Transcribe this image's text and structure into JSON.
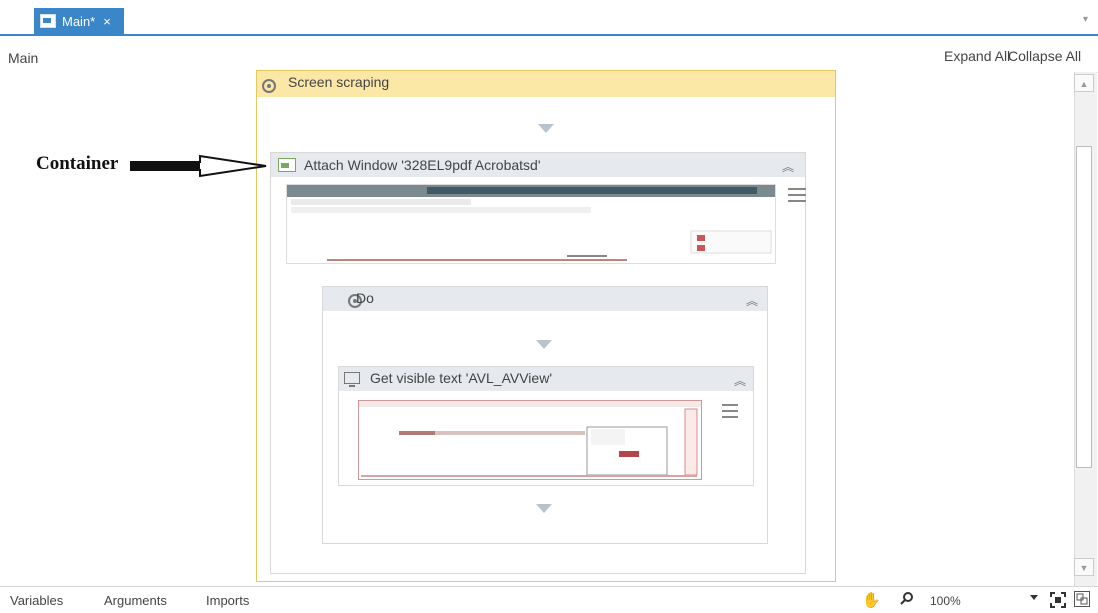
{
  "tab": {
    "label": "Main*",
    "close": "×"
  },
  "header": {
    "breadcrumb": "Main",
    "expand_all": "Expand All",
    "collapse_all": "Collapse All"
  },
  "annotation": {
    "label": "Container"
  },
  "sequence": {
    "title": "Screen scraping"
  },
  "attach": {
    "title": "Attach Window '328EL9pdf Acrobatsd'"
  },
  "do": {
    "title": "Do"
  },
  "get_visible_text": {
    "title": "Get visible text 'AVL_AVView'"
  },
  "bottom": {
    "variables": "Variables",
    "arguments": "Arguments",
    "imports": "Imports",
    "zoom": "100%"
  },
  "icons": [
    "gear-icon",
    "collapse-icon",
    "menu-icon",
    "hand-icon",
    "search-icon",
    "fit-icon",
    "overview-icon"
  ]
}
